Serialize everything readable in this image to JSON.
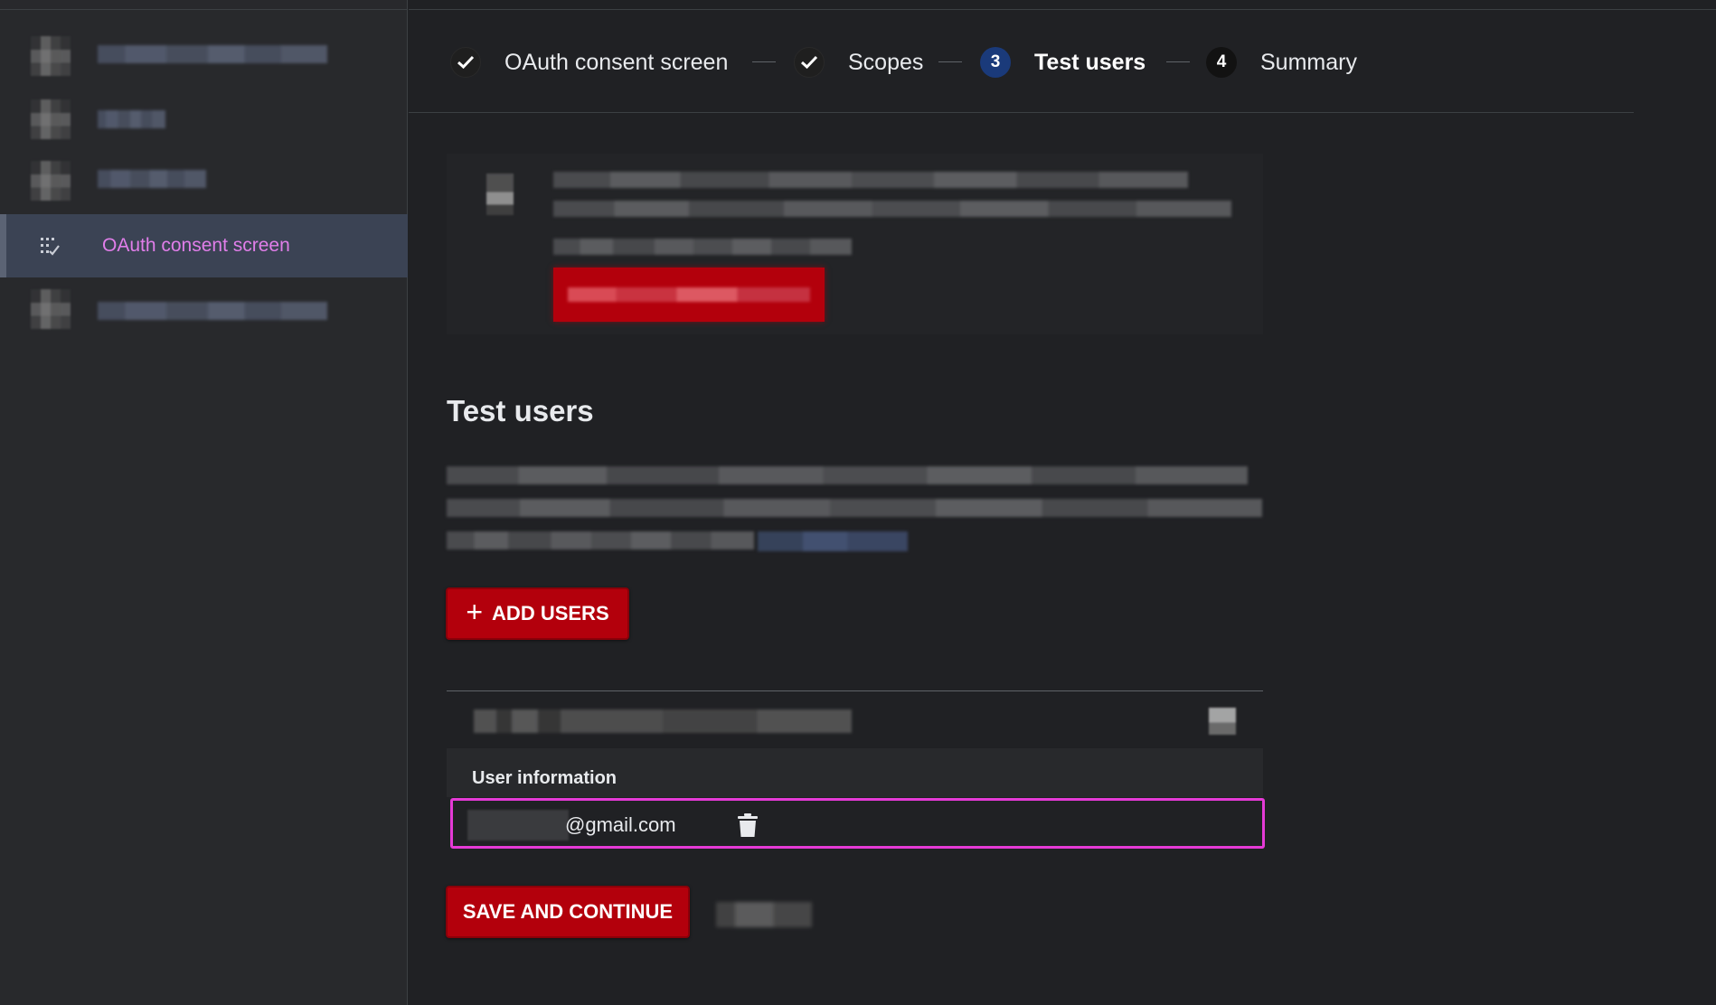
{
  "sidebar": {
    "active_item": {
      "label": "OAuth consent screen",
      "icon": "oauth-consent-icon"
    }
  },
  "stepper": {
    "steps": [
      {
        "label": "OAuth consent screen",
        "status": "done",
        "icon": "check-icon"
      },
      {
        "label": "Scopes",
        "status": "done",
        "icon": "check-icon"
      },
      {
        "label": "Test users",
        "status": "current",
        "number": "3"
      },
      {
        "label": "Summary",
        "status": "todo",
        "number": "4"
      }
    ]
  },
  "section": {
    "title": "Test users",
    "add_button_label": "ADD USERS"
  },
  "users_table": {
    "header": "User information",
    "rows": [
      {
        "email_suffix": "@gmail.com"
      }
    ]
  },
  "actions": {
    "save_label": "SAVE AND CONTINUE"
  },
  "colors": {
    "primary_red": "#b3000c",
    "highlight": "#e53ad6",
    "active_nav_text": "#e07ee9",
    "current_step": "#1a3a7a"
  }
}
